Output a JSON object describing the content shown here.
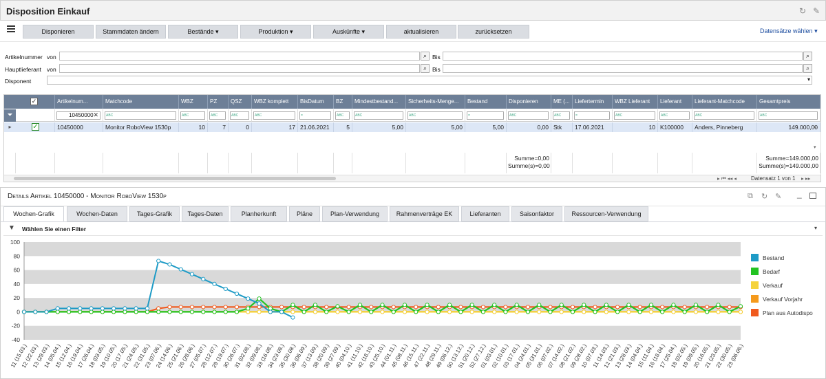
{
  "window": {
    "title": "Disposition Einkauf"
  },
  "toolbar": {
    "buttons": [
      "Disponieren",
      "Stammdaten ändern",
      "Bestände",
      "Produktion",
      "Auskünfte",
      "aktualisieren",
      "zurücksetzen"
    ],
    "dropdown_flags": [
      false,
      false,
      true,
      true,
      true,
      false,
      false
    ],
    "select_records": "Datensätze wählen"
  },
  "filters": {
    "article_label": "Artikelnummer",
    "from_label": "von",
    "to_label": "Bis",
    "supplier_label": "Hauptlieferant",
    "dispatcher_label": "Disponent"
  },
  "grid": {
    "columns": [
      "Artikelnum...",
      "Matchcode",
      "WBZ",
      "PZ",
      "QSZ",
      "WBZ komplett",
      "BisDatum",
      "BZ",
      "Mindestbestand...",
      "Sicherheits-Menge...",
      "Bestand",
      "Disponieren",
      "ME (...",
      "Liefertermin",
      "WBZ Lieferant",
      "Lieferant",
      "Lieferant-Matchcode",
      "Gesamtpreis"
    ],
    "filter_article": "10450000",
    "row": {
      "article": "10450000",
      "matchcode": "Monitor RoboView 1530p",
      "wbz": "10",
      "pz": "7",
      "qsz": "0",
      "wbz_komplett": "17",
      "bisdatum": "21.06.2021",
      "bz": "5",
      "mindest": "5,00",
      "sicherheit": "5,00",
      "bestand": "5,00",
      "disponieren": "0,00",
      "me": "Stk",
      "liefertermin": "17.06.2021",
      "wbz_lieferant": "10",
      "lieferant": "K100000",
      "lieferant_matchcode": "Anders, Pinneberg",
      "gesamtpreis": "149.000,00"
    },
    "sum_dispo_1": "Summe=0,00",
    "sum_dispo_2": "Summe(s)=0,00",
    "sum_price_1": "Summe=149.000,00",
    "sum_price_2": "Summe(s)=149.000,00",
    "pager": "Datensatz 1 von 1"
  },
  "details": {
    "title": "Details Artikel 10450000 - Monitor RoboView 1530p",
    "tabs": [
      "Wochen-Grafik",
      "Wochen-Daten",
      "Tages-Grafik",
      "Tages-Daten",
      "Planherkunft",
      "Pläne",
      "Plan-Verwendung",
      "Rahmenverträge EK",
      "Lieferanten",
      "Saisonfaktor",
      "Ressourcen-Verwendung"
    ],
    "filter_label": "Wählen Sie einen Filter"
  },
  "chart_data": {
    "type": "line",
    "ylim": [
      -40,
      100
    ],
    "yticks": [
      -40,
      -20,
      0,
      20,
      40,
      60,
      80,
      100
    ],
    "grid": true,
    "legend": "right",
    "categories": [
      "11 (15.03.)",
      "12 (22.03.)",
      "13 (29.03.)",
      "14 (05.04.)",
      "15 (12.04.)",
      "16 (19.04.)",
      "17 (26.04.)",
      "18 (03.05.)",
      "19 (10.05.)",
      "20 (17.05.)",
      "21 (24.05.)",
      "22 (31.05.)",
      "23 (07.06.)",
      "24 (14.06.)",
      "25 (21.06.)",
      "26 (28.06.)",
      "27 (05.07.)",
      "28 (12.07.)",
      "29 (19.07.)",
      "30 (26.07.)",
      "31 (02.08.)",
      "32 (09.08.)",
      "33 (16.08.)",
      "34 (23.08.)",
      "35 (30.08.)",
      "36 (06.09.)",
      "37 (13.09.)",
      "38 (20.09.)",
      "39 (27.09.)",
      "40 (04.10.)",
      "41 (11.10.)",
      "42 (18.10.)",
      "43 (25.10.)",
      "44 (01.11.)",
      "45 (08.11.)",
      "46 (15.11.)",
      "47 (22.11.)",
      "48 (29.11.)",
      "49 (06.12.)",
      "50 (13.12.)",
      "51 (20.12.)",
      "52 (27.12.)",
      "01 (03.01.)",
      "02 (10.01.)",
      "03 (17.01.)",
      "04 (24.01.)",
      "05 (31.01.)",
      "06 (07.02.)",
      "07 (14.02.)",
      "08 (21.02.)",
      "09 (28.02.)",
      "10 (07.03.)",
      "11 (14.03.)",
      "12 (21.03.)",
      "13 (28.03.)",
      "14 (04.04.)",
      "15 (11.04.)",
      "16 (18.04.)",
      "17 (25.04.)",
      "18 (02.05.)",
      "19 (09.05.)",
      "20 (16.05.)",
      "21 (23.05.)",
      "22 (30.05.)",
      "23 (06.06.)"
    ],
    "series": [
      {
        "name": "Bestand",
        "color": "#1e9bc6",
        "values": [
          0,
          0,
          0,
          5,
          5,
          5,
          5,
          5,
          5,
          5,
          5,
          5,
          73,
          68,
          61,
          54,
          47,
          40,
          33,
          26,
          19,
          12,
          0,
          0,
          -8,
          null,
          null,
          null,
          null,
          null,
          null,
          null,
          null,
          null,
          null,
          null,
          null,
          null,
          null,
          null,
          null,
          null,
          null,
          null,
          null,
          null,
          null,
          null,
          null,
          null,
          null,
          null,
          null,
          null,
          null,
          null,
          null,
          null,
          null,
          null,
          null,
          null,
          null,
          null,
          null
        ]
      },
      {
        "name": "Bedarf",
        "color": "#22c322",
        "values": [
          0,
          0,
          0,
          0,
          0,
          0,
          0,
          0,
          0,
          0,
          0,
          0,
          0,
          0,
          0,
          0,
          0,
          0,
          0,
          0,
          5,
          19,
          5,
          0,
          10,
          0,
          10,
          0,
          8,
          0,
          10,
          0,
          10,
          0,
          10,
          0,
          10,
          0,
          10,
          0,
          10,
          0,
          10,
          0,
          10,
          0,
          10,
          0,
          10,
          0,
          10,
          0,
          10,
          0,
          10,
          0,
          10,
          0,
          10,
          0,
          10,
          0,
          10,
          0,
          8
        ]
      },
      {
        "name": "Verkauf",
        "color": "#f5d33c",
        "values": [
          0,
          0,
          0,
          0,
          0,
          0,
          0,
          0,
          0,
          0,
          0,
          0,
          0,
          0,
          0,
          0,
          0,
          0,
          0,
          0,
          0,
          0,
          0,
          0,
          0,
          0,
          0,
          0,
          0,
          0,
          0,
          0,
          0,
          0,
          0,
          0,
          0,
          0,
          0,
          0,
          0,
          0,
          0,
          0,
          0,
          0,
          0,
          0,
          0,
          0,
          0,
          0,
          0,
          0,
          0,
          0,
          0,
          0,
          0,
          0,
          0,
          0,
          0,
          0,
          0
        ]
      },
      {
        "name": "Verkauf Vorjahr",
        "color": "#f59a1c",
        "values": [
          0,
          0,
          0,
          0,
          0,
          0,
          0,
          0,
          0,
          0,
          0,
          0,
          0,
          0,
          0,
          0,
          0,
          0,
          0,
          0,
          0,
          0,
          0,
          0,
          0,
          0,
          0,
          0,
          0,
          0,
          0,
          0,
          0,
          0,
          0,
          0,
          0,
          0,
          0,
          0,
          0,
          0,
          0,
          0,
          0,
          0,
          0,
          0,
          0,
          0,
          0,
          0,
          0,
          0,
          0,
          0,
          0,
          0,
          0,
          0,
          0,
          0,
          0,
          0,
          0
        ]
      },
      {
        "name": "Plan aus Autodispo",
        "color": "#f05a1e",
        "values": [
          0,
          0,
          0,
          0,
          0,
          0,
          0,
          0,
          0,
          0,
          0,
          0,
          5,
          7,
          7,
          7,
          7,
          7,
          7,
          7,
          7,
          7,
          7,
          7,
          7,
          7,
          7,
          7,
          7,
          7,
          7,
          7,
          7,
          7,
          7,
          7,
          7,
          7,
          7,
          7,
          7,
          7,
          7,
          7,
          7,
          7,
          7,
          7,
          7,
          7,
          7,
          7,
          7,
          7,
          7,
          7,
          7,
          7,
          7,
          7,
          7,
          7,
          7,
          7,
          7
        ]
      }
    ]
  }
}
